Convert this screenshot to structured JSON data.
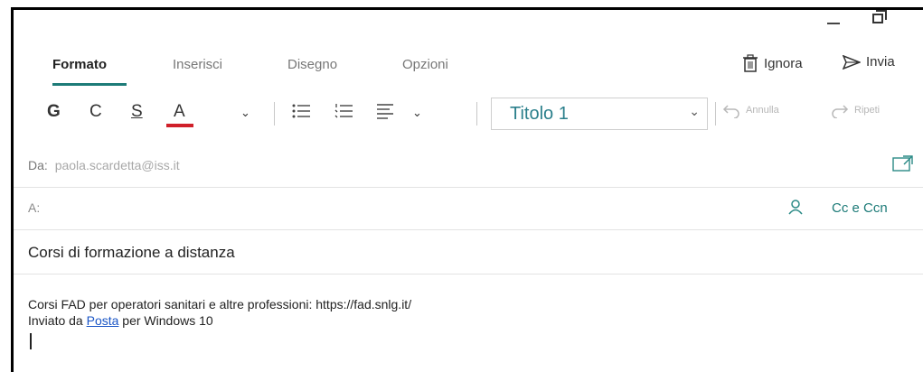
{
  "window": {
    "minimize_icon": "minimize-icon",
    "restore_icon": "restore-icon"
  },
  "tabs": [
    {
      "label": "Formato",
      "active": true
    },
    {
      "label": "Inserisci",
      "active": false
    },
    {
      "label": "Disegno",
      "active": false
    },
    {
      "label": "Opzioni",
      "active": false
    }
  ],
  "actions": {
    "discard": "Ignora",
    "send": "Invia"
  },
  "toolbar": {
    "bold": "G",
    "italic": "C",
    "underline": "S",
    "font_color": "A",
    "font_color_hex": "#d0202a",
    "style_value": "Titolo 1",
    "undo": "Annulla",
    "redo": "Ripeti"
  },
  "from": {
    "label": "Da:",
    "value": "paola.scardetta@iss.it"
  },
  "to": {
    "label": "A:",
    "cc_bcc": "Cc e Ccn"
  },
  "subject": "Corsi di formazione a distanza",
  "body": {
    "line1": "Corsi FAD per operatori sanitari e altre professioni: https://fad.snlg.it/",
    "sent_prefix": "Inviato da ",
    "sent_link": "Posta",
    "sent_suffix": " per Windows 10"
  },
  "colors": {
    "accent": "#1d7b78",
    "style_text": "#2a7f8b",
    "link": "#1a55c6"
  }
}
